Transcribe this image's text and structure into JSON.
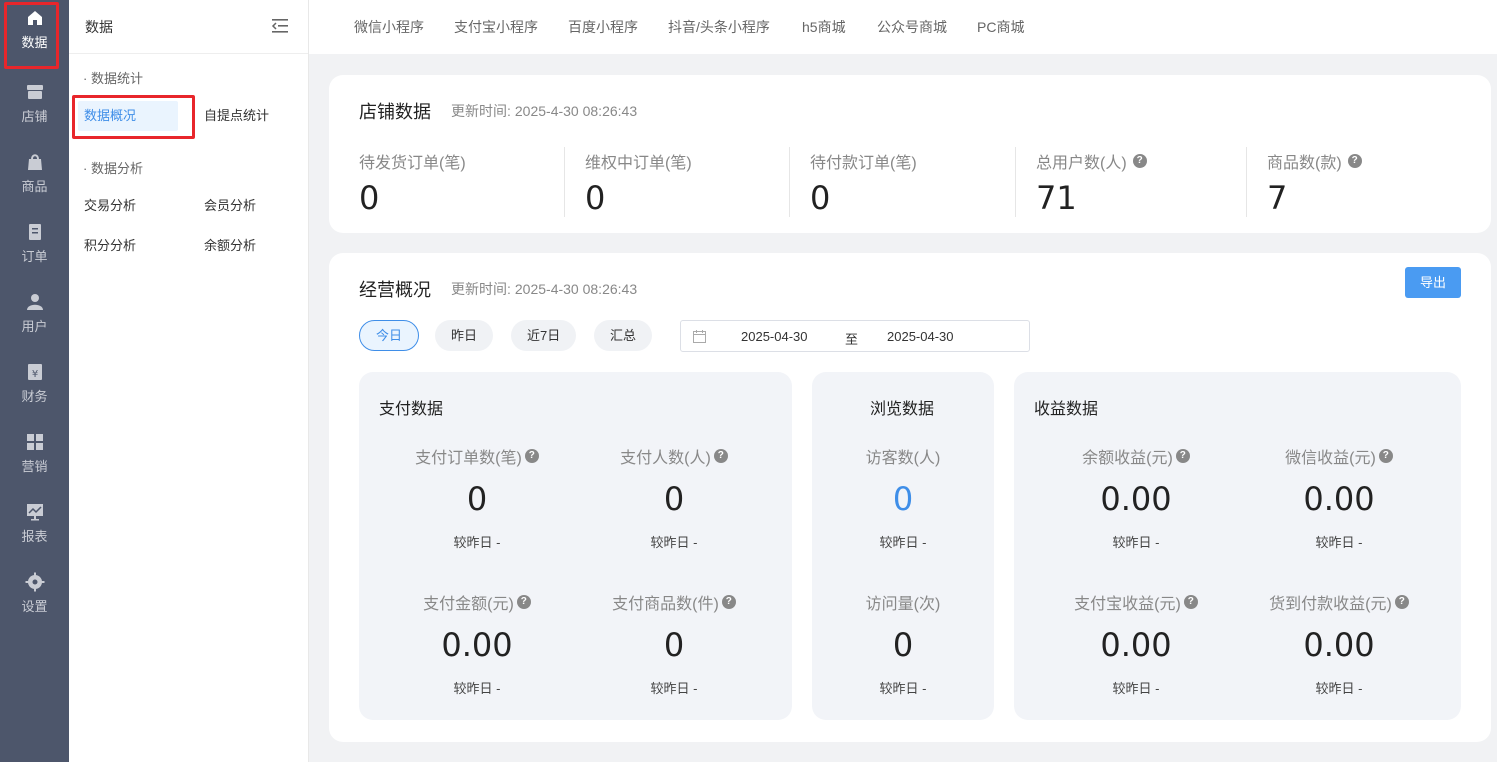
{
  "nav": {
    "items": [
      {
        "label": "数据",
        "icon": "home-icon"
      },
      {
        "label": "店铺",
        "icon": "store-icon"
      },
      {
        "label": "商品",
        "icon": "bag-icon"
      },
      {
        "label": "订单",
        "icon": "document-icon"
      },
      {
        "label": "用户",
        "icon": "user-icon"
      },
      {
        "label": "财务",
        "icon": "yen-icon"
      },
      {
        "label": "营销",
        "icon": "grid-icon"
      },
      {
        "label": "报表",
        "icon": "chart-icon"
      },
      {
        "label": "设置",
        "icon": "gear-icon"
      }
    ]
  },
  "submenu": {
    "title": "数据",
    "group1": "· 数据统计",
    "link_overview": "数据概况",
    "link_pickup": "自提点统计",
    "group2": "· 数据分析",
    "link_trade": "交易分析",
    "link_member": "会员分析",
    "link_points": "积分分析",
    "link_balance": "余额分析"
  },
  "tabs": [
    "微信小程序",
    "支付宝小程序",
    "百度小程序",
    "抖音/头条小程序",
    "h5商城",
    "公众号商城",
    "PC商城"
  ],
  "store": {
    "title": "店铺数据",
    "update_label": "更新时间:",
    "update_time": "2025-4-30 08:26:43",
    "stats": [
      {
        "label": "待发货订单(笔)",
        "value": "0"
      },
      {
        "label": "维权中订单(笔)",
        "value": "0"
      },
      {
        "label": "待付款订单(笔)",
        "value": "0"
      },
      {
        "label": "总用户数(人)",
        "value": "71"
      },
      {
        "label": "商品数(款)",
        "value": "7"
      }
    ]
  },
  "business": {
    "title": "经营概况",
    "update_label": "更新时间:",
    "update_time": "2025-4-30 08:26:43",
    "export_label": "导出",
    "ranges": [
      "今日",
      "昨日",
      "近7日",
      "汇总"
    ],
    "date_start": "2025-04-30",
    "date_sep": "至",
    "date_end": "2025-04-30",
    "compare_label": "较昨日 -",
    "pay": {
      "title": "支付数据",
      "metrics": [
        {
          "label": "支付订单数(笔)",
          "value": "0"
        },
        {
          "label": "支付人数(人)",
          "value": "0"
        },
        {
          "label": "支付金额(元)",
          "value": "0.00"
        },
        {
          "label": "支付商品数(件)",
          "value": "0"
        }
      ]
    },
    "browse": {
      "title": "浏览数据",
      "metrics": [
        {
          "label": "访客数(人)",
          "value": "0"
        },
        {
          "label": "访问量(次)",
          "value": "0"
        }
      ]
    },
    "income": {
      "title": "收益数据",
      "metrics": [
        {
          "label": "余额收益(元)",
          "value": "0.00"
        },
        {
          "label": "微信收益(元)",
          "value": "0.00"
        },
        {
          "label": "支付宝收益(元)",
          "value": "0.00"
        },
        {
          "label": "货到付款收益(元)",
          "value": "0.00"
        }
      ]
    }
  },
  "colors": {
    "accent": "#3f8ee8",
    "nav_bg": "#4d566b",
    "highlight": "#e8262b"
  }
}
